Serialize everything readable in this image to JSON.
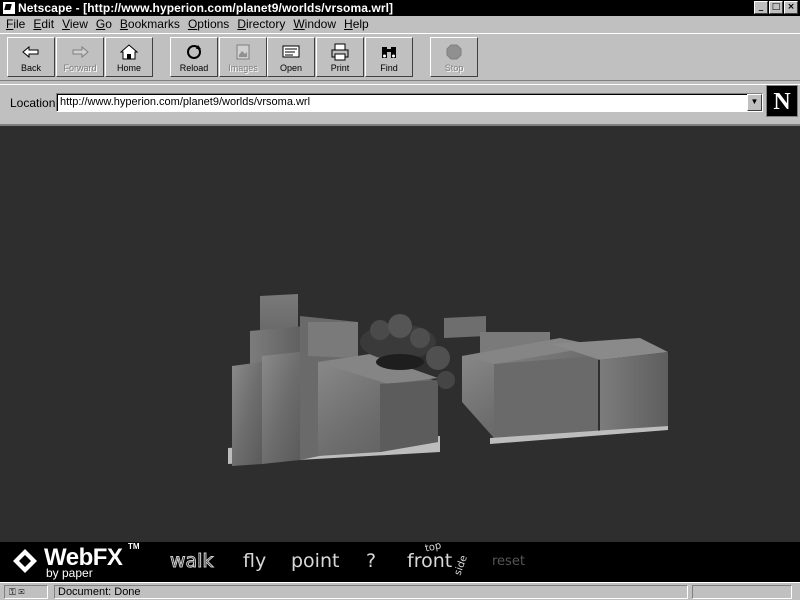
{
  "window": {
    "title": "Netscape - [http://www.hyperion.com/planet9/worlds/vrsoma.wrl]",
    "controls": [
      "_",
      "□",
      "×"
    ]
  },
  "menu": [
    {
      "label": "File",
      "accel": "F",
      "rest": "ile"
    },
    {
      "label": "Edit",
      "accel": "E",
      "rest": "dit"
    },
    {
      "label": "View",
      "accel": "V",
      "rest": "iew"
    },
    {
      "label": "Go",
      "accel": "G",
      "rest": "o"
    },
    {
      "label": "Bookmarks",
      "accel": "B",
      "rest": "ookmarks"
    },
    {
      "label": "Options",
      "accel": "O",
      "rest": "ptions"
    },
    {
      "label": "Directory",
      "accel": "D",
      "rest": "irectory"
    },
    {
      "label": "Window",
      "accel": "W",
      "rest": "indow"
    },
    {
      "label": "Help",
      "accel": "H",
      "rest": "elp"
    }
  ],
  "toolbar": {
    "back": "Back",
    "forward": "Forward",
    "home": "Home",
    "reload": "Reload",
    "images": "Images",
    "open": "Open",
    "print": "Print",
    "find": "Find",
    "stop": "Stop"
  },
  "location": {
    "label": "Location:",
    "url": "http://www.hyperion.com/planet9/worlds/vrsoma.wrl",
    "logo": "N"
  },
  "webfx": {
    "brand": "WebFX",
    "tm": "TM",
    "byline": "by paper",
    "walk": "walk",
    "fly": "fly",
    "point": "point",
    "help": "?",
    "front": "front",
    "top": "top",
    "side": "side",
    "reset": "reset"
  },
  "status": {
    "text": "Document: Done"
  }
}
